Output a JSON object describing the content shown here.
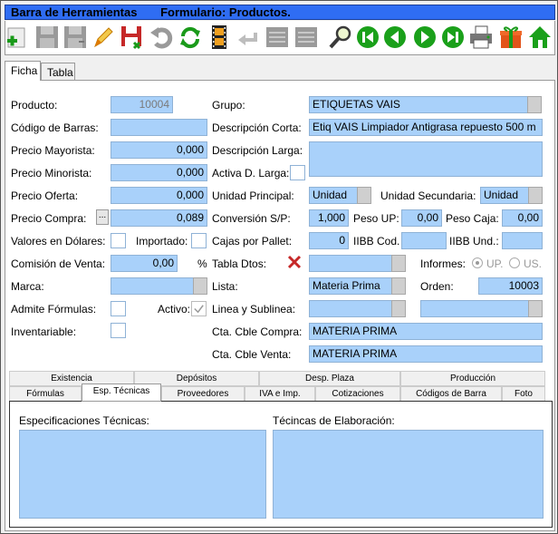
{
  "window": {
    "title_left": "Barra de Herramientas",
    "title_right": "Formulario: Productos."
  },
  "toolbar": {
    "buttons": [
      "add-icon",
      "save-icon",
      "save-as-icon",
      "edit-icon",
      "save-exit-icon",
      "undo-icon",
      "refresh-icon",
      "film-icon",
      "back-arrow-icon",
      "list-icon",
      "list2-icon",
      "search-icon",
      "first-icon",
      "prev-icon",
      "next-icon",
      "last-icon",
      "print-icon",
      "gift-icon",
      "home-icon"
    ]
  },
  "tabs": [
    "Ficha",
    "Tabla"
  ],
  "form": {
    "producto_label": "Producto:",
    "producto_value": "10004",
    "codigo_barras_label": "Código de Barras:",
    "codigo_barras_value": "",
    "precio_mayorista_label": "Precio Mayorista:",
    "precio_mayorista_value": "0,000",
    "precio_minorista_label": "Precio Minorista:",
    "precio_minorista_value": "0,000",
    "precio_oferta_label": "Precio Oferta:",
    "precio_oferta_value": "0,000",
    "precio_compra_label": "Precio Compra:",
    "precio_compra_btn": "...",
    "precio_compra_value": "0,089",
    "valores_dolares_label": "Valores en Dólares:",
    "importado_label": "Importado:",
    "comision_label": "Comisión de Venta:",
    "comision_value": "0,00",
    "pct": "%",
    "marca_label": "Marca:",
    "marca_value": "",
    "admite_formulas_label": "Admite Fórmulas:",
    "activo_label": "Activo:",
    "inventariable_label": "Inventariable:",
    "grupo_label": "Grupo:",
    "grupo_value": "ETIQUETAS VAIS",
    "desc_corta_label": "Descripción Corta:",
    "desc_corta_value": "Etiq VAIS Limpiador Antigrasa repuesto 500 m",
    "desc_larga_label": "Descripción Larga:",
    "activa_d_larga_label": "Activa D. Larga:",
    "unidad_principal_label": "Unidad Principal:",
    "unidad_principal_value": "Unidad",
    "unidad_secundaria_label": "Unidad Secundaria:",
    "unidad_secundaria_value": "Unidad",
    "conversion_label": "Conversión S/P:",
    "conversion_value": "1,000",
    "peso_up_label": "Peso UP:",
    "peso_up_value": "0,00",
    "peso_caja_label": "Peso Caja:",
    "peso_caja_value": "0,00",
    "cajas_pallet_label": "Cajas por Pallet:",
    "cajas_pallet_value": "0",
    "iibb_cod_label": "IIBB Cod.",
    "iibb_cod_value": "",
    "iibb_und_label": "IIBB Und.:",
    "iibb_und_value": "",
    "tabla_dtos_label": "Tabla Dtos:",
    "tabla_dtos_value": "",
    "informes_label": "Informes:",
    "informes_up": "UP.",
    "informes_us": "US.",
    "lista_label": "Lista:",
    "lista_value": "Materia Prima",
    "orden_label": "Orden:",
    "orden_value": "10003",
    "linea_label": "Linea y Sublinea:",
    "cta_compra_label": "Cta. Cble Compra:",
    "cta_compra_value": "MATERIA PRIMA",
    "cta_venta_label": "Cta. Cble Venta:",
    "cta_venta_value": "MATERIA PRIMA"
  },
  "subtabs": {
    "row1": [
      "Existencia",
      "Depósitos",
      "Desp. Plaza",
      "Producción"
    ],
    "row2": [
      "Fórmulas",
      "Esp. Técnicas",
      "Proveedores",
      "IVA e Imp.",
      "Cotizaciones",
      "Códigos de Barra",
      "Foto"
    ]
  },
  "esp_tecnicas": {
    "spec_label": "Especificaciones Técnicas:",
    "elab_label": "Técincas de Elaboración:"
  },
  "colors": {
    "title_bg": "#2f6df3",
    "field_bg": "#a9d1fa"
  }
}
